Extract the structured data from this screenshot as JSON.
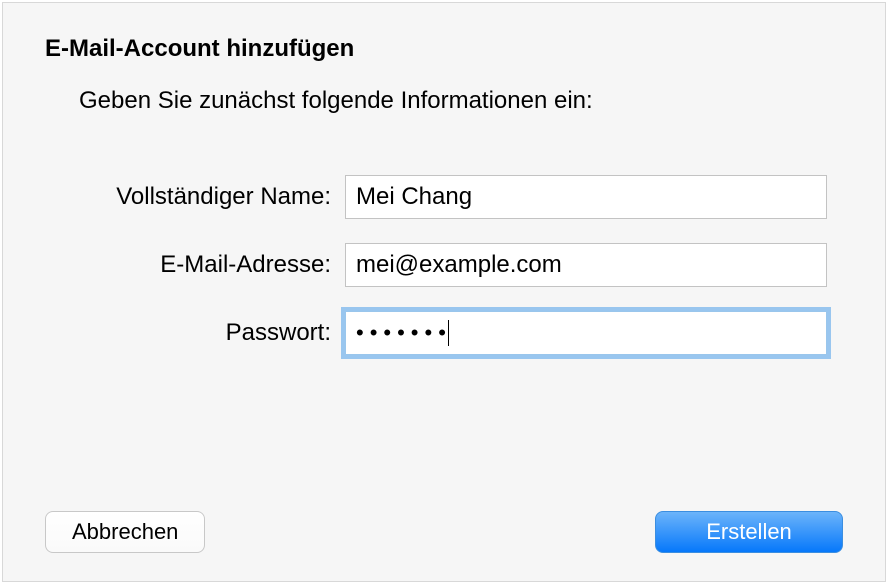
{
  "dialog": {
    "title": "E-Mail-Account hinzufügen",
    "subtitle": "Geben Sie zunächst folgende Informationen ein:"
  },
  "fields": {
    "fullname": {
      "label": "Vollständiger Name:",
      "value": "Mei Chang"
    },
    "email": {
      "label": "E-Mail-Adresse:",
      "value": "mei@example.com"
    },
    "password": {
      "label": "Passwort:",
      "value": "•••••••"
    }
  },
  "buttons": {
    "cancel": "Abbrechen",
    "create": "Erstellen"
  }
}
